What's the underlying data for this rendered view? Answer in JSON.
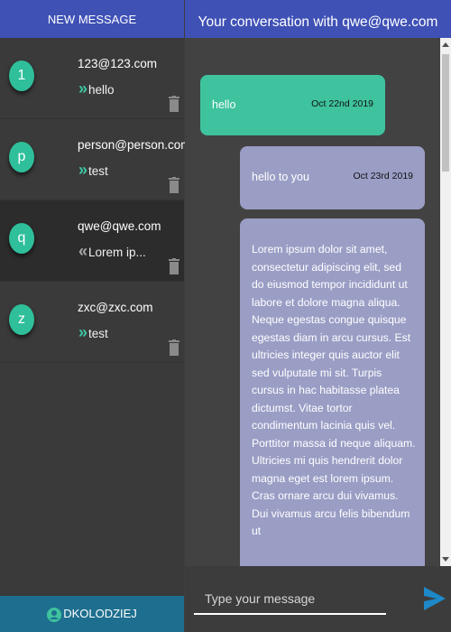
{
  "sidebar": {
    "new_message_label": "NEW MESSAGE",
    "conversations": [
      {
        "avatar_letter": "1",
        "email": "123@123.com",
        "preview": "hello",
        "direction": "outgoing"
      },
      {
        "avatar_letter": "p",
        "email": "person@person.com",
        "preview": "test",
        "direction": "outgoing"
      },
      {
        "avatar_letter": "q",
        "email": "qwe@qwe.com",
        "preview": "Lorem ip...",
        "direction": "incoming",
        "active": true
      },
      {
        "avatar_letter": "z",
        "email": "zxc@zxc.com",
        "preview": "test",
        "direction": "outgoing"
      }
    ],
    "user": {
      "username": "DKOLODZIEJ",
      "icon": "account-circle-icon"
    }
  },
  "chat": {
    "header": "Your conversation with qwe@qwe.com",
    "messages": [
      {
        "text": "hello",
        "date": "Oct 22nd 2019",
        "sender": "me"
      },
      {
        "text": "hello to you",
        "date": "Oct 23rd 2019",
        "sender": "them"
      },
      {
        "text": "Lorem ipsum dolor sit amet, consectetur adipiscing elit, sed do eiusmod tempor incididunt ut labore et dolore magna aliqua. Neque egestas congue quisque egestas diam in arcu cursus. Est ultricies integer quis auctor elit sed vulputate mi sit. Turpis cursus in hac habitasse platea dictumst. Vitae tortor condimentum lacinia quis vel. Porttitor massa id neque aliquam. Ultricies mi quis hendrerit dolor magna eget est lorem ipsum. Cras ornare arcu dui vivamus. Dui vivamus arcu felis bibendum ut",
        "sender": "them"
      }
    ],
    "input_placeholder": "Type your message"
  },
  "colors": {
    "header_blue": "#3f51b5",
    "accent_green": "#3ec39e",
    "incoming_bubble": "#9a9ec5",
    "user_bar": "#1e6f8f"
  }
}
